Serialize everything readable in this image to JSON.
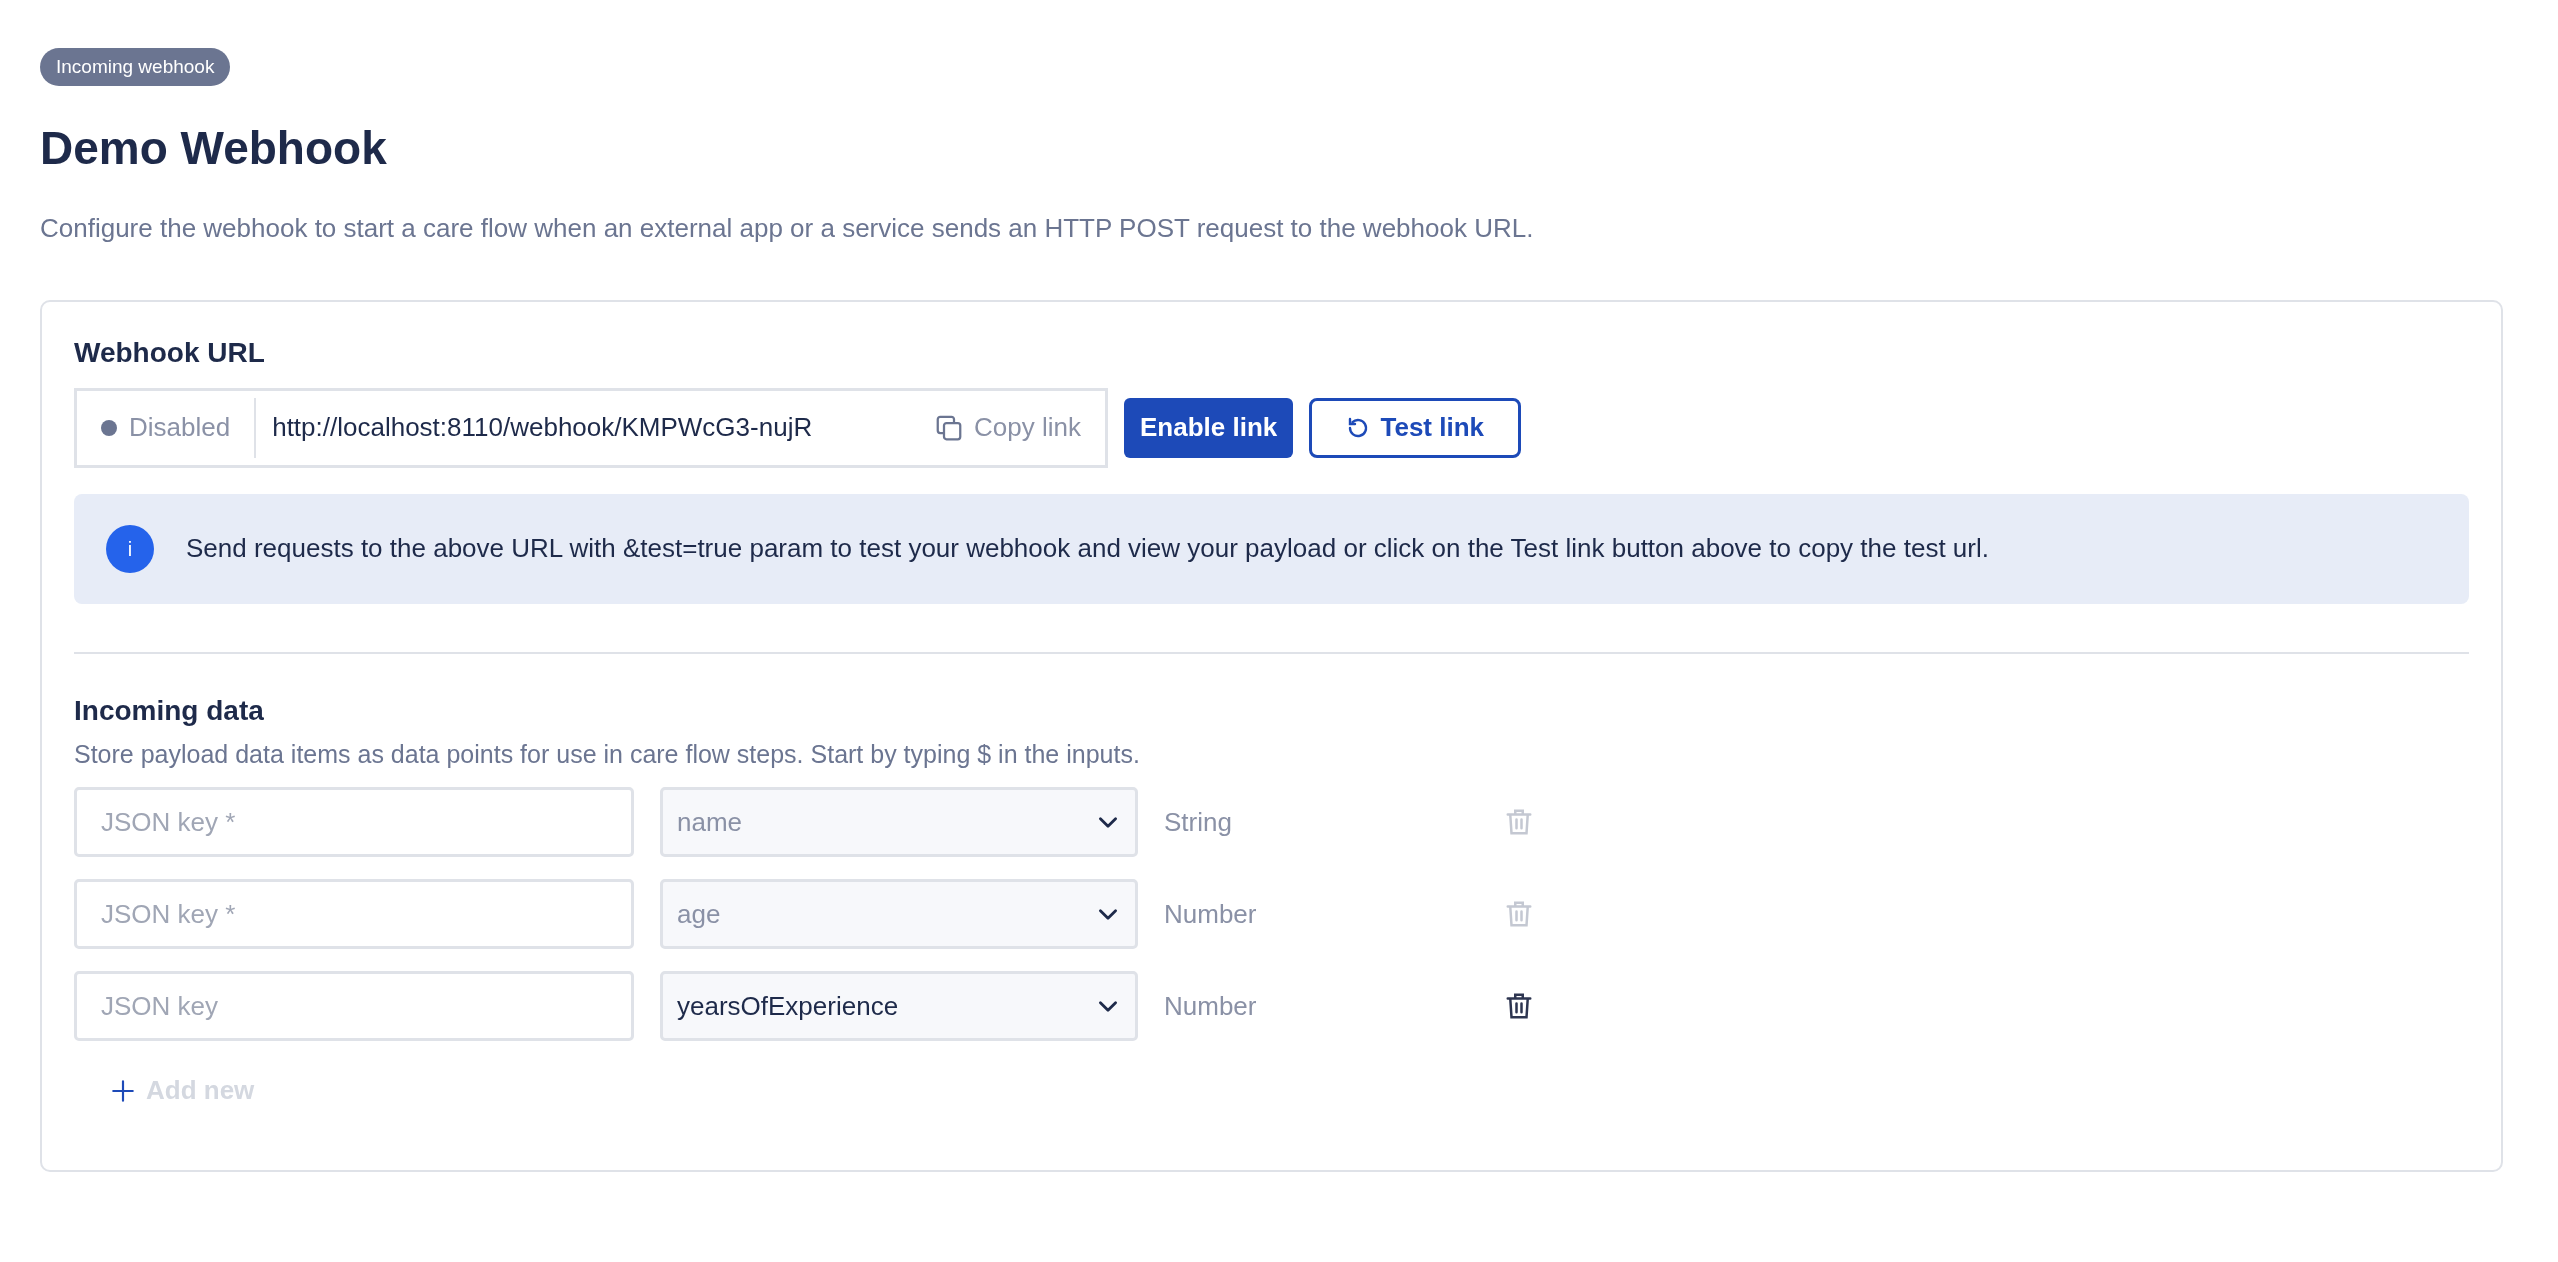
{
  "badge": "Incoming webhook",
  "title": "Demo Webhook",
  "description": "Configure the webhook to start a care flow when an external app or a service sends an HTTP POST request to the webhook URL.",
  "webhook_url": {
    "heading": "Webhook URL",
    "status": {
      "label": "Disabled",
      "enabled": false
    },
    "url": "http://localhost:8110/webhook/KMPWcG3-nujR",
    "copy_label": "Copy link",
    "enable_button": "Enable link",
    "test_button": "Test link"
  },
  "info": {
    "icon_text": "i",
    "message": "Send requests to the above URL with &test=true param to test your webhook and view your payload or click on the Test link button above to copy the test url."
  },
  "incoming_data": {
    "heading": "Incoming data",
    "subtitle": "Store payload data items as data points for use in care flow steps. Start by typing $ in the inputs.",
    "rows": [
      {
        "key_placeholder": "JSON key *",
        "field": "name",
        "type": "String",
        "disabled": true
      },
      {
        "key_placeholder": "JSON key *",
        "field": "age",
        "type": "Number",
        "disabled": true
      },
      {
        "key_placeholder": "JSON key",
        "field": "yearsOfExperience",
        "type": "Number",
        "disabled": false
      }
    ],
    "add_new": {
      "label": "Add new",
      "disabled": true
    }
  }
}
